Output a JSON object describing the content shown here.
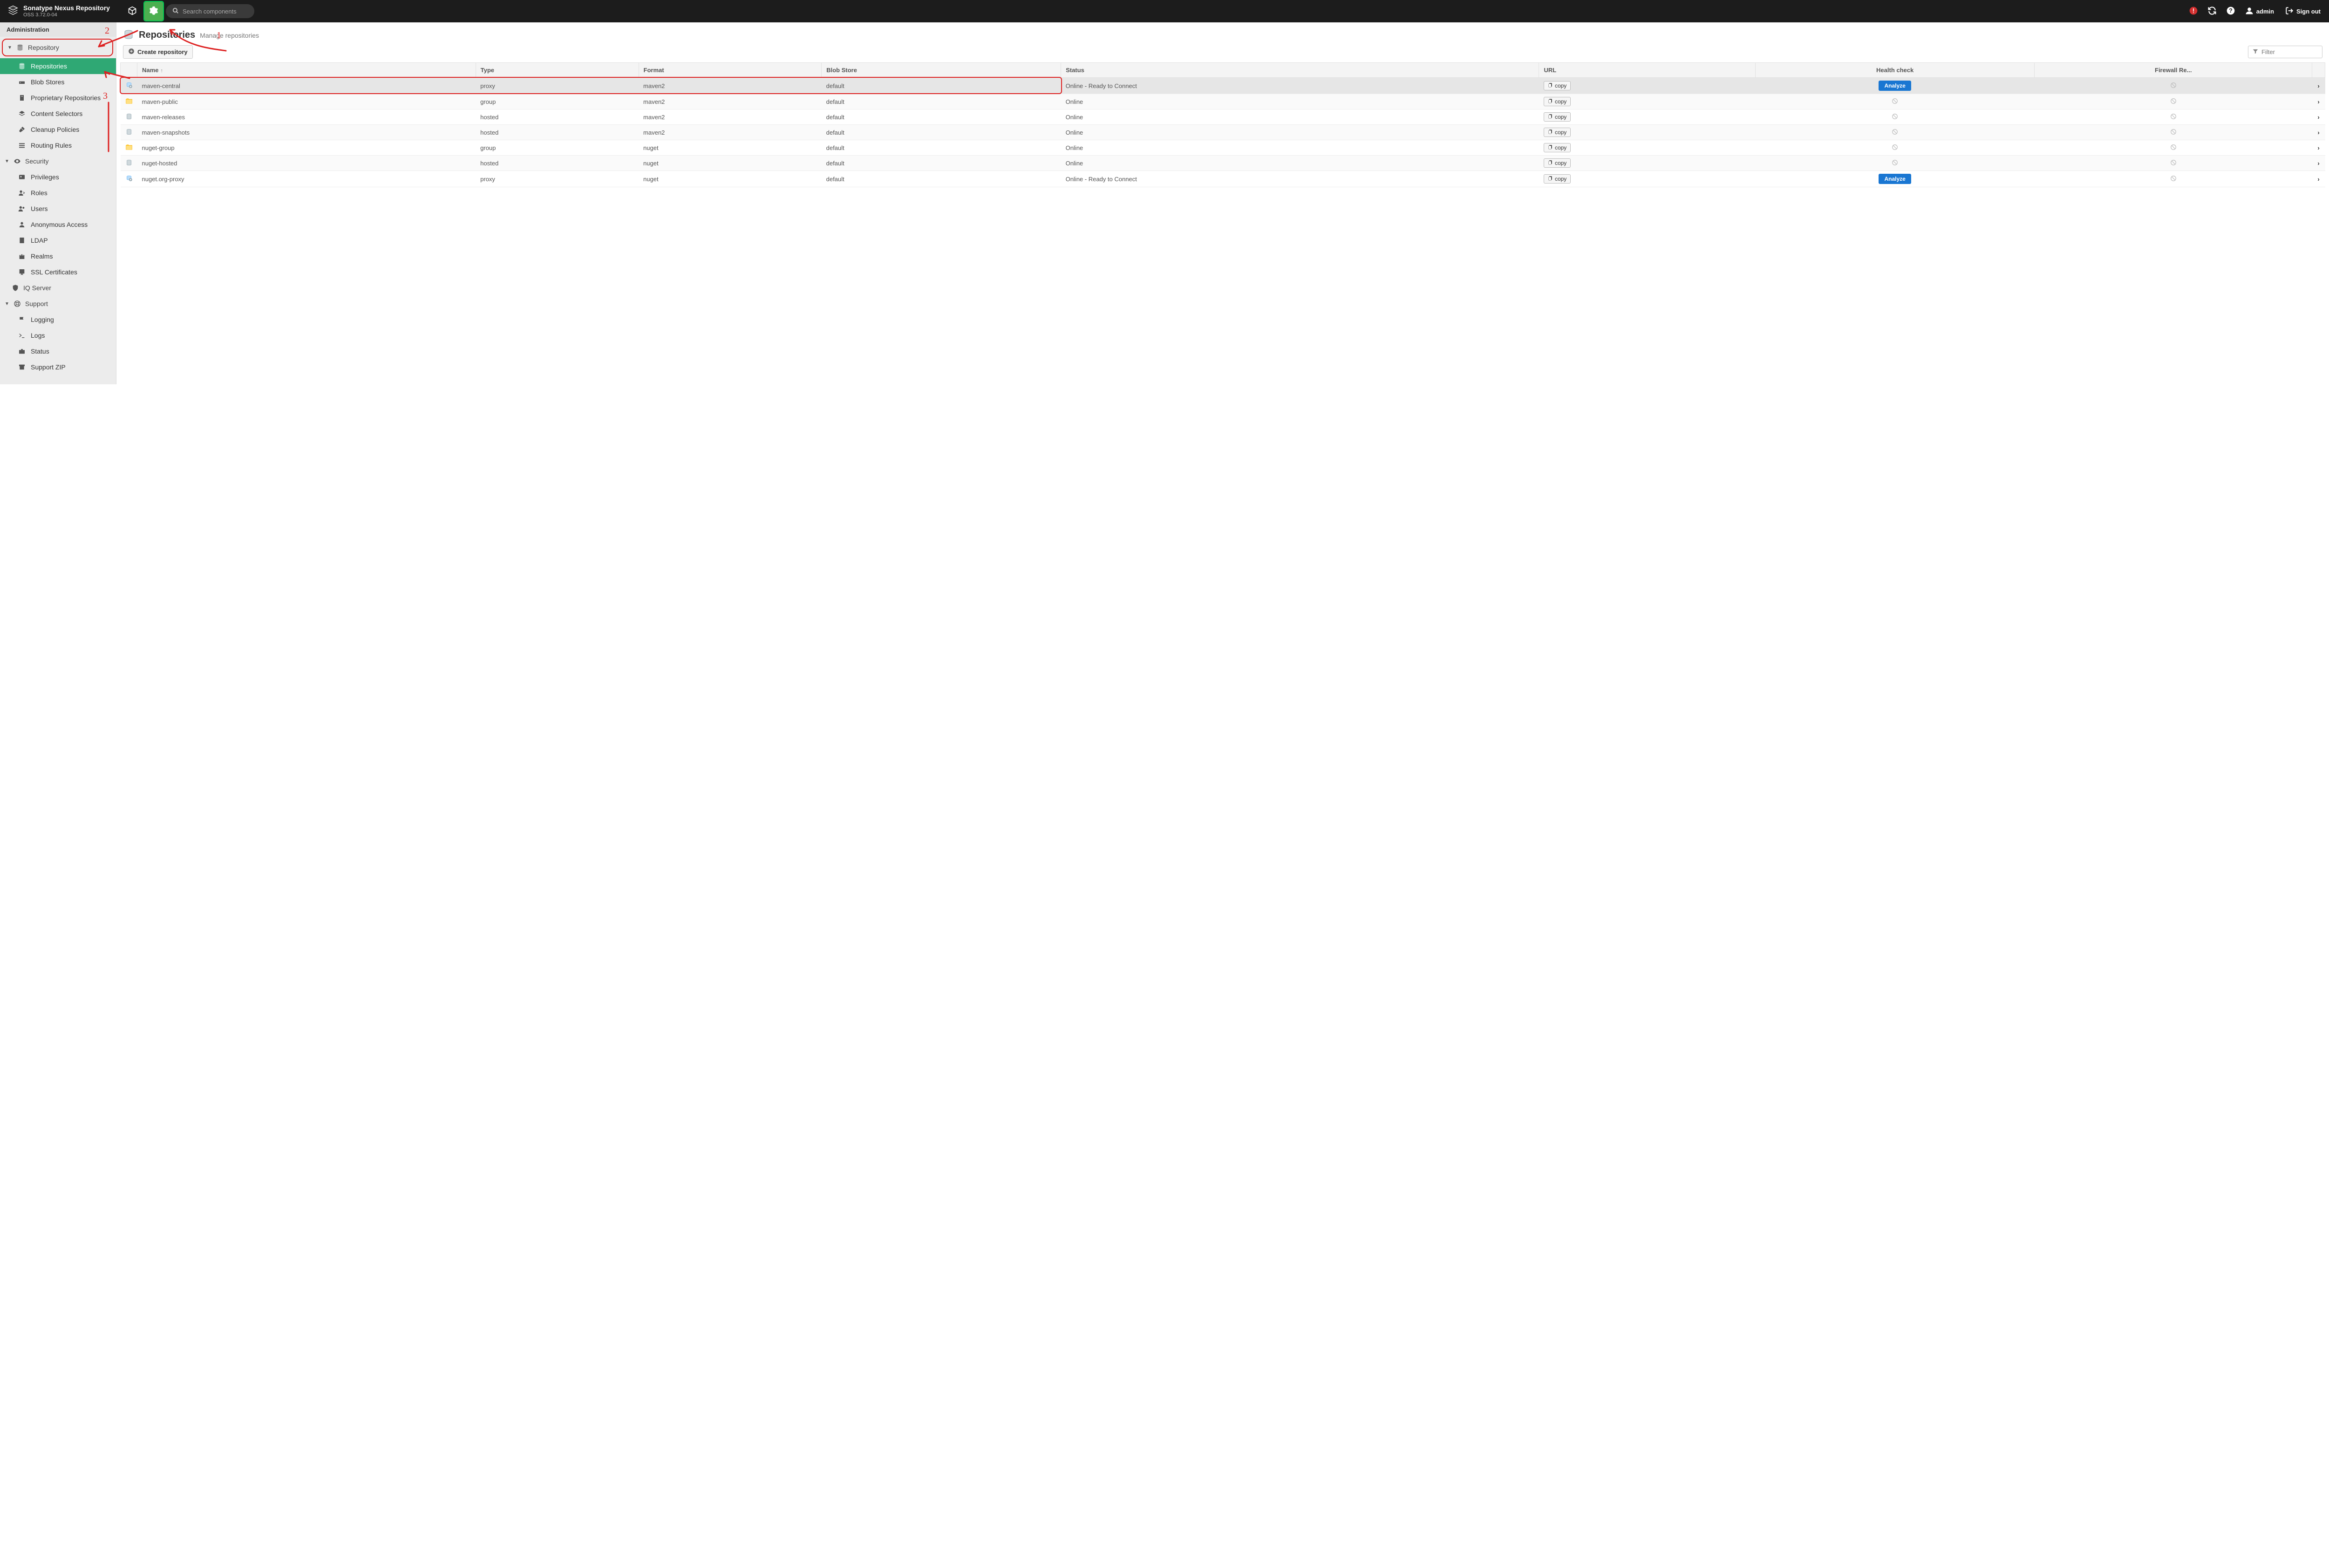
{
  "header": {
    "product_name": "Sonatype Nexus Repository",
    "product_version": "OSS 3.72.0-04",
    "search_placeholder": "Search components",
    "user_label": "admin",
    "signout_label": "Sign out"
  },
  "sidebar": {
    "admin_label": "Administration",
    "groups": [
      {
        "id": "repository",
        "label": "Repository",
        "expanded": true,
        "outlined": true,
        "items": [
          {
            "id": "repositories",
            "label": "Repositories",
            "active": true,
            "icon": "database"
          },
          {
            "id": "blobstores",
            "label": "Blob Stores",
            "icon": "hdd"
          },
          {
            "id": "proprietary",
            "label": "Proprietary Repositories",
            "icon": "building"
          },
          {
            "id": "contentselectors",
            "label": "Content Selectors",
            "icon": "layers"
          },
          {
            "id": "cleanup",
            "label": "Cleanup Policies",
            "icon": "broom"
          },
          {
            "id": "routing",
            "label": "Routing Rules",
            "icon": "route"
          }
        ]
      },
      {
        "id": "security",
        "label": "Security",
        "expanded": true,
        "items": [
          {
            "id": "privileges",
            "label": "Privileges",
            "icon": "idcard"
          },
          {
            "id": "roles",
            "label": "Roles",
            "icon": "userrole"
          },
          {
            "id": "users",
            "label": "Users",
            "icon": "users"
          },
          {
            "id": "anon",
            "label": "Anonymous Access",
            "icon": "person"
          },
          {
            "id": "ldap",
            "label": "LDAP",
            "icon": "book"
          },
          {
            "id": "realms",
            "label": "Realms",
            "icon": "castle"
          },
          {
            "id": "ssl",
            "label": "SSL Certificates",
            "icon": "cert"
          }
        ]
      },
      {
        "id": "iq",
        "label": "IQ Server",
        "expanded": false,
        "is_leaf_group": true,
        "icon": "shield"
      },
      {
        "id": "support",
        "label": "Support",
        "expanded": true,
        "items": [
          {
            "id": "logging",
            "label": "Logging",
            "icon": "flag"
          },
          {
            "id": "logs",
            "label": "Logs",
            "icon": "terminal"
          },
          {
            "id": "status",
            "label": "Status",
            "icon": "briefcase"
          },
          {
            "id": "zip",
            "label": "Support ZIP",
            "icon": "archive"
          }
        ]
      }
    ]
  },
  "page": {
    "title": "Repositories",
    "subtitle": "Manage repositories",
    "create_label": "Create repository",
    "filter_placeholder": "Filter"
  },
  "table": {
    "columns": [
      "Name",
      "Type",
      "Format",
      "Blob Store",
      "Status",
      "URL",
      "Health check",
      "Firewall Re..."
    ],
    "copy_label": "copy",
    "analyze_label": "Analyze",
    "rows": [
      {
        "name": "maven-central",
        "type": "proxy",
        "format": "maven2",
        "blob": "default",
        "status": "Online - Ready to Connect",
        "health": "analyze",
        "selected": true,
        "outlined": true,
        "icon": "proxy"
      },
      {
        "name": "maven-public",
        "type": "group",
        "format": "maven2",
        "blob": "default",
        "status": "Online",
        "health": "disabled",
        "icon": "group"
      },
      {
        "name": "maven-releases",
        "type": "hosted",
        "format": "maven2",
        "blob": "default",
        "status": "Online",
        "health": "disabled",
        "icon": "hosted"
      },
      {
        "name": "maven-snapshots",
        "type": "hosted",
        "format": "maven2",
        "blob": "default",
        "status": "Online",
        "health": "disabled",
        "icon": "hosted"
      },
      {
        "name": "nuget-group",
        "type": "group",
        "format": "nuget",
        "blob": "default",
        "status": "Online",
        "health": "disabled",
        "icon": "group"
      },
      {
        "name": "nuget-hosted",
        "type": "hosted",
        "format": "nuget",
        "blob": "default",
        "status": "Online",
        "health": "disabled",
        "icon": "hosted"
      },
      {
        "name": "nuget.org-proxy",
        "type": "proxy",
        "format": "nuget",
        "blob": "default",
        "status": "Online - Ready to Connect",
        "health": "analyze",
        "icon": "proxy"
      }
    ]
  },
  "annotations": {
    "step1": "1",
    "step2": "2",
    "step3": "3"
  }
}
